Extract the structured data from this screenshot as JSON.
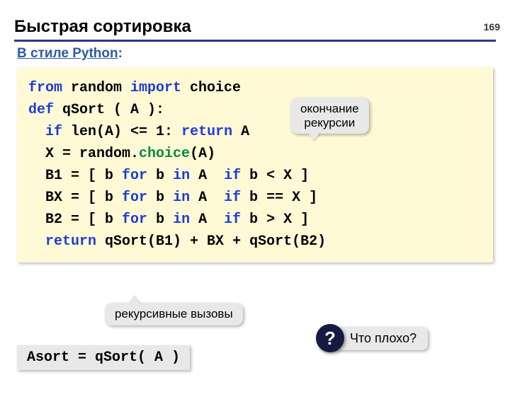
{
  "page_number": "169",
  "title": "Быстрая сортировка",
  "subtitle_prefix": "В стиле Python",
  "subtitle_suffix": ":",
  "code": {
    "line1": {
      "t1": "from",
      "t2": " random ",
      "t3": "import",
      "t4": " choice"
    },
    "line2": {
      "t1": "def",
      "t2": " qSort ( A ):"
    },
    "line3": {
      "indent": "  ",
      "t1": "if",
      "t2": " len(A) <= 1: ",
      "t3": "return",
      "t4": " A"
    },
    "line4": {
      "indent": "  ",
      "t1": "X = random.",
      "t2": "choice",
      "t3": "(A)      "
    },
    "line5": {
      "indent": "  ",
      "t1": "B1 = [ b ",
      "t2": "for",
      "t3": " b ",
      "t4": "in",
      "t5": " A ",
      "t6": " if",
      "t7": " b < X ]"
    },
    "line6": {
      "indent": "  ",
      "t1": "BX = [ b ",
      "t2": "for",
      "t3": " b ",
      "t4": "in",
      "t5": " A ",
      "t6": " if",
      "t7": " b == X ]"
    },
    "line7": {
      "indent": "  ",
      "t1": "B2 = [ b ",
      "t2": "for",
      "t3": " b ",
      "t4": "in",
      "t5": " A ",
      "t6": " if",
      "t7": " b > X ]"
    },
    "line8": {
      "indent": "  ",
      "t1": "return",
      "t2": " qSort(B1) + BX + qSort(B2)"
    }
  },
  "callout_recursion_end": "окончание\nрекурсии",
  "callout_recursive_calls": "рекурсивные вызовы",
  "usage_example": "Asort = qSort( A )",
  "question_mark": "?",
  "question_text": "Что плохо?"
}
